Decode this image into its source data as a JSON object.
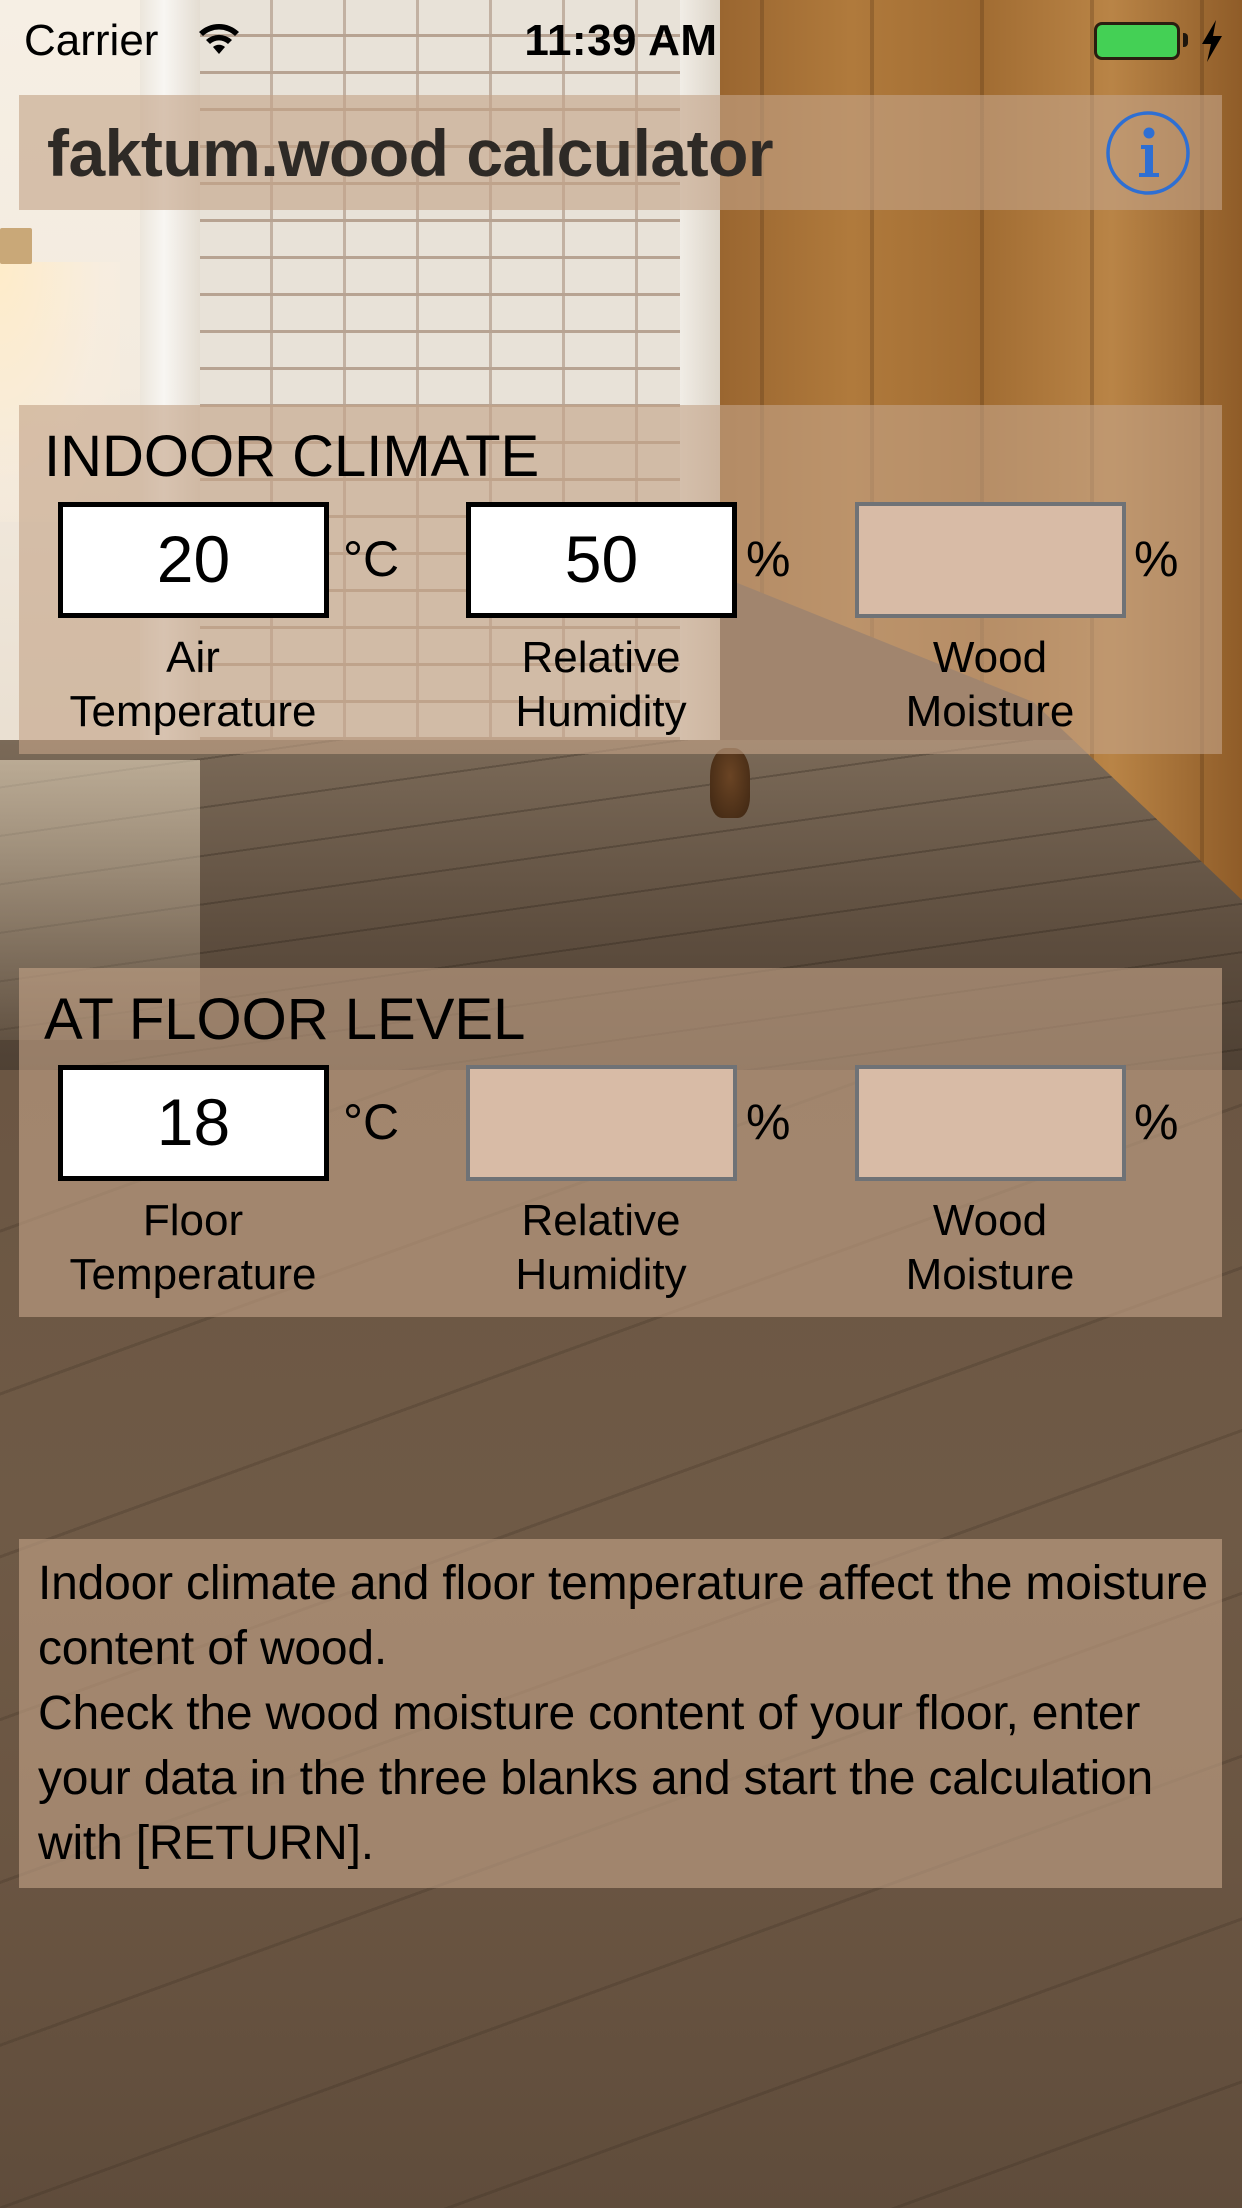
{
  "status_bar": {
    "carrier": "Carrier",
    "time": "11:39 AM",
    "wifi_icon": "wifi-icon",
    "battery_icon": "battery-full-charging-icon",
    "battery_color": "#44d055"
  },
  "header": {
    "title": "faktum.wood calculator",
    "info_icon": "info-icon",
    "accent_color": "#2e6fd3"
  },
  "indoor_climate": {
    "title": "INDOOR CLIMATE",
    "fields": [
      {
        "label_line1": "Air",
        "label_line2": "Temperature",
        "value": "20",
        "unit": "°C",
        "editable": true
      },
      {
        "label_line1": "Relative",
        "label_line2": "Humidity",
        "value": "50",
        "unit": "%",
        "editable": true
      },
      {
        "label_line1": "Wood",
        "label_line2": "Moisture",
        "value": "",
        "unit": "%",
        "editable": false
      }
    ]
  },
  "floor_level": {
    "title": "AT FLOOR LEVEL",
    "fields": [
      {
        "label_line1": "Floor",
        "label_line2": "Temperature",
        "value": "18",
        "unit": "°C",
        "editable": true
      },
      {
        "label_line1": "Relative",
        "label_line2": "Humidity",
        "value": "",
        "unit": "%",
        "editable": false
      },
      {
        "label_line1": "Wood",
        "label_line2": "Moisture",
        "value": "",
        "unit": "%",
        "editable": false
      }
    ]
  },
  "info": {
    "paragraph1": "Indoor climate and floor temperature affect the moisture content of wood.",
    "paragraph2": "Check the wood moisture content of your floor, enter your data in the three blanks and start the calculation with [RETURN]."
  },
  "colors": {
    "panel_overlay": "#c4a388",
    "result_field_bg": "#d8bba6",
    "result_field_border": "#6f7276",
    "editable_field_border": "#000000"
  }
}
